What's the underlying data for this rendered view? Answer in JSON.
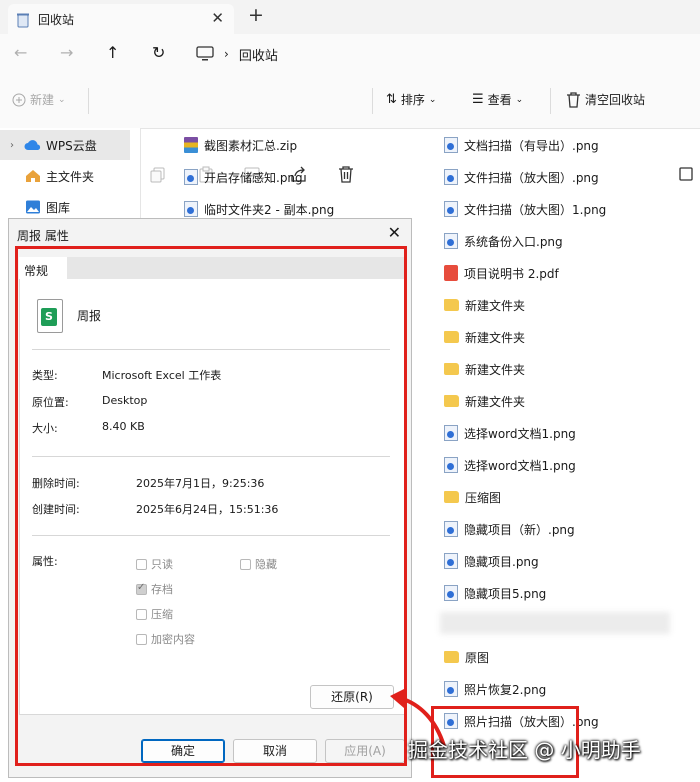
{
  "window": {
    "tab_title": "回收站",
    "new_tab": "+",
    "close": "✕"
  },
  "nav": {
    "back": "←",
    "forward": "→",
    "up": "↑",
    "refresh": "↻",
    "breadcrumb": [
      "回收站"
    ]
  },
  "toolbar": {
    "new": "新建",
    "sort": "排序",
    "view": "查看",
    "empty_bin": "清空回收站"
  },
  "sidebar": {
    "items": [
      {
        "label": "WPS云盘",
        "icon": "cloud-icon",
        "expandable": true,
        "selected": true
      },
      {
        "label": "主文件夹",
        "icon": "home-icon"
      },
      {
        "label": "图库",
        "icon": "gallery-icon"
      }
    ]
  },
  "files_col1": [
    {
      "name": "截图素材汇总.zip",
      "type": "zip"
    },
    {
      "name": "开启存储感知.png",
      "type": "png"
    },
    {
      "name": "临时文件夹2 - 副本.png",
      "type": "png"
    }
  ],
  "files_col2": [
    {
      "name": "文档扫描（有导出）.png",
      "type": "png"
    },
    {
      "name": "文件扫描（放大图）.png",
      "type": "png"
    },
    {
      "name": "文件扫描（放大图）1.png",
      "type": "png"
    },
    {
      "name": "系统备份入口.png",
      "type": "png"
    },
    {
      "name": "项目说明书 2.pdf",
      "type": "pdf"
    },
    {
      "name": "新建文件夹",
      "type": "folder"
    },
    {
      "name": "新建文件夹",
      "type": "folder"
    },
    {
      "name": "新建文件夹",
      "type": "folder"
    },
    {
      "name": "新建文件夹",
      "type": "folder"
    },
    {
      "name": "选择word文档1.png",
      "type": "png"
    },
    {
      "name": "选择word文档1.png",
      "type": "png"
    },
    {
      "name": "压缩图",
      "type": "folder"
    },
    {
      "name": "隐藏项目（新）.png",
      "type": "png"
    },
    {
      "name": "隐藏项目.png",
      "type": "png"
    },
    {
      "name": "隐藏项目5.png",
      "type": "png"
    },
    {
      "name": "原图",
      "type": "folder"
    },
    {
      "name": "照片恢复2.png",
      "type": "png"
    },
    {
      "name": "照片扫描（放大图）.png",
      "type": "png"
    }
  ],
  "dialog": {
    "title": "周报 属性",
    "tab_general": "常规",
    "file_name": "周报",
    "icon_letter": "S",
    "type_label": "类型:",
    "type_value": "Microsoft Excel 工作表",
    "location_label": "原位置:",
    "location_value": "Desktop",
    "size_label": "大小:",
    "size_value": "8.40 KB",
    "deleted_label": "删除时间:",
    "deleted_value": "2025年7月1日，9:25:36",
    "created_label": "创建时间:",
    "created_value": "2025年6月24日，15:51:36",
    "attributes_label": "属性:",
    "attr_readonly": "只读",
    "attr_hidden": "隐藏",
    "attr_archive": "存档",
    "attr_compress": "压缩",
    "attr_encrypt": "加密内容",
    "restore_button": "还原(R)",
    "ok_button": "确定",
    "cancel_button": "取消",
    "apply_button": "应用(A)"
  },
  "watermark": "掘金技术社区 @ 小明助手",
  "colors": {
    "highlight_red": "#e0201b",
    "accent_blue": "#0067c0",
    "excel_green": "#1e9d57"
  }
}
